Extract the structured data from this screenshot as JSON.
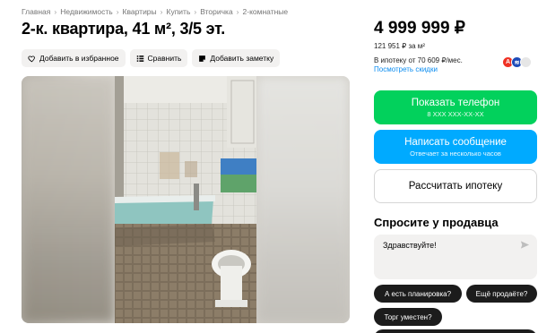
{
  "breadcrumbs": [
    "Главная",
    "Недвижимость",
    "Квартиры",
    "Купить",
    "Вторичка",
    "2-комнатные"
  ],
  "listing": {
    "title": "2-к. квартира, 41 м², 3/5 эт."
  },
  "actions": {
    "favorite": "Добавить в избранное",
    "compare": "Сравнить",
    "note": "Добавить заметку"
  },
  "price": {
    "value": "4 999 999 ₽",
    "per_meter": "121 951 ₽ за м²",
    "installment": "В ипотеку от 70 609 ₽/мес.",
    "discounts_link": "Посмотреть скидки"
  },
  "buttons": {
    "phone_label": "Показать телефон",
    "phone_masked": "8 XXX XXX-XX-XX",
    "message_label": "Написать сообщение",
    "message_sub": "Отвечает за несколько часов",
    "mortgage_label": "Рассчитать ипотеку"
  },
  "ask": {
    "title": "Спросите у продавца",
    "input_value": "Здравствуйте!",
    "chips": [
      "А есть планировка?",
      "Ещё продаёте?",
      "Торг уместен?"
    ]
  },
  "colors": {
    "green": "#02d15c",
    "blue": "#00aaff",
    "link": "#0a8cf0",
    "chip": "#1c1c1c"
  }
}
